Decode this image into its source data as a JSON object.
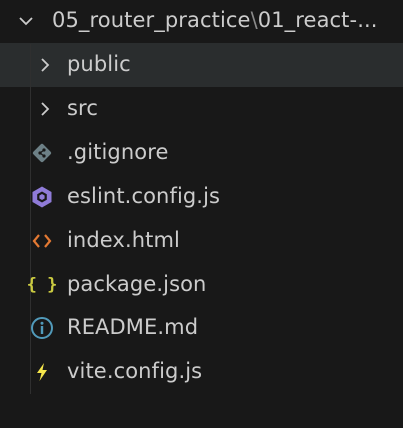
{
  "explorer": {
    "folder": {
      "name": "05_router_practice",
      "separator": "\\",
      "subpath": "01_react-..."
    },
    "items": [
      {
        "label": "public",
        "type": "folder",
        "icon": "chevron-right-icon"
      },
      {
        "label": "src",
        "type": "folder",
        "icon": "chevron-right-icon"
      },
      {
        "label": ".gitignore",
        "type": "file",
        "icon": "git-icon"
      },
      {
        "label": "eslint.config.js",
        "type": "file",
        "icon": "eslint-icon"
      },
      {
        "label": "index.html",
        "type": "file",
        "icon": "html-icon"
      },
      {
        "label": "package.json",
        "type": "file",
        "icon": "json-icon",
        "glyph": "{ }"
      },
      {
        "label": "README.md",
        "type": "file",
        "icon": "info-icon"
      },
      {
        "label": "vite.config.js",
        "type": "file",
        "icon": "vite-icon"
      }
    ],
    "colors": {
      "background": "#181818",
      "hover": "#2a2d2e",
      "text": "#cccccc",
      "eslint": "#8f7bd8",
      "html": "#e37933",
      "json": "#cbcb41",
      "info": "#519aba",
      "vite": "#f5e64b",
      "git": "#6d8086"
    }
  }
}
